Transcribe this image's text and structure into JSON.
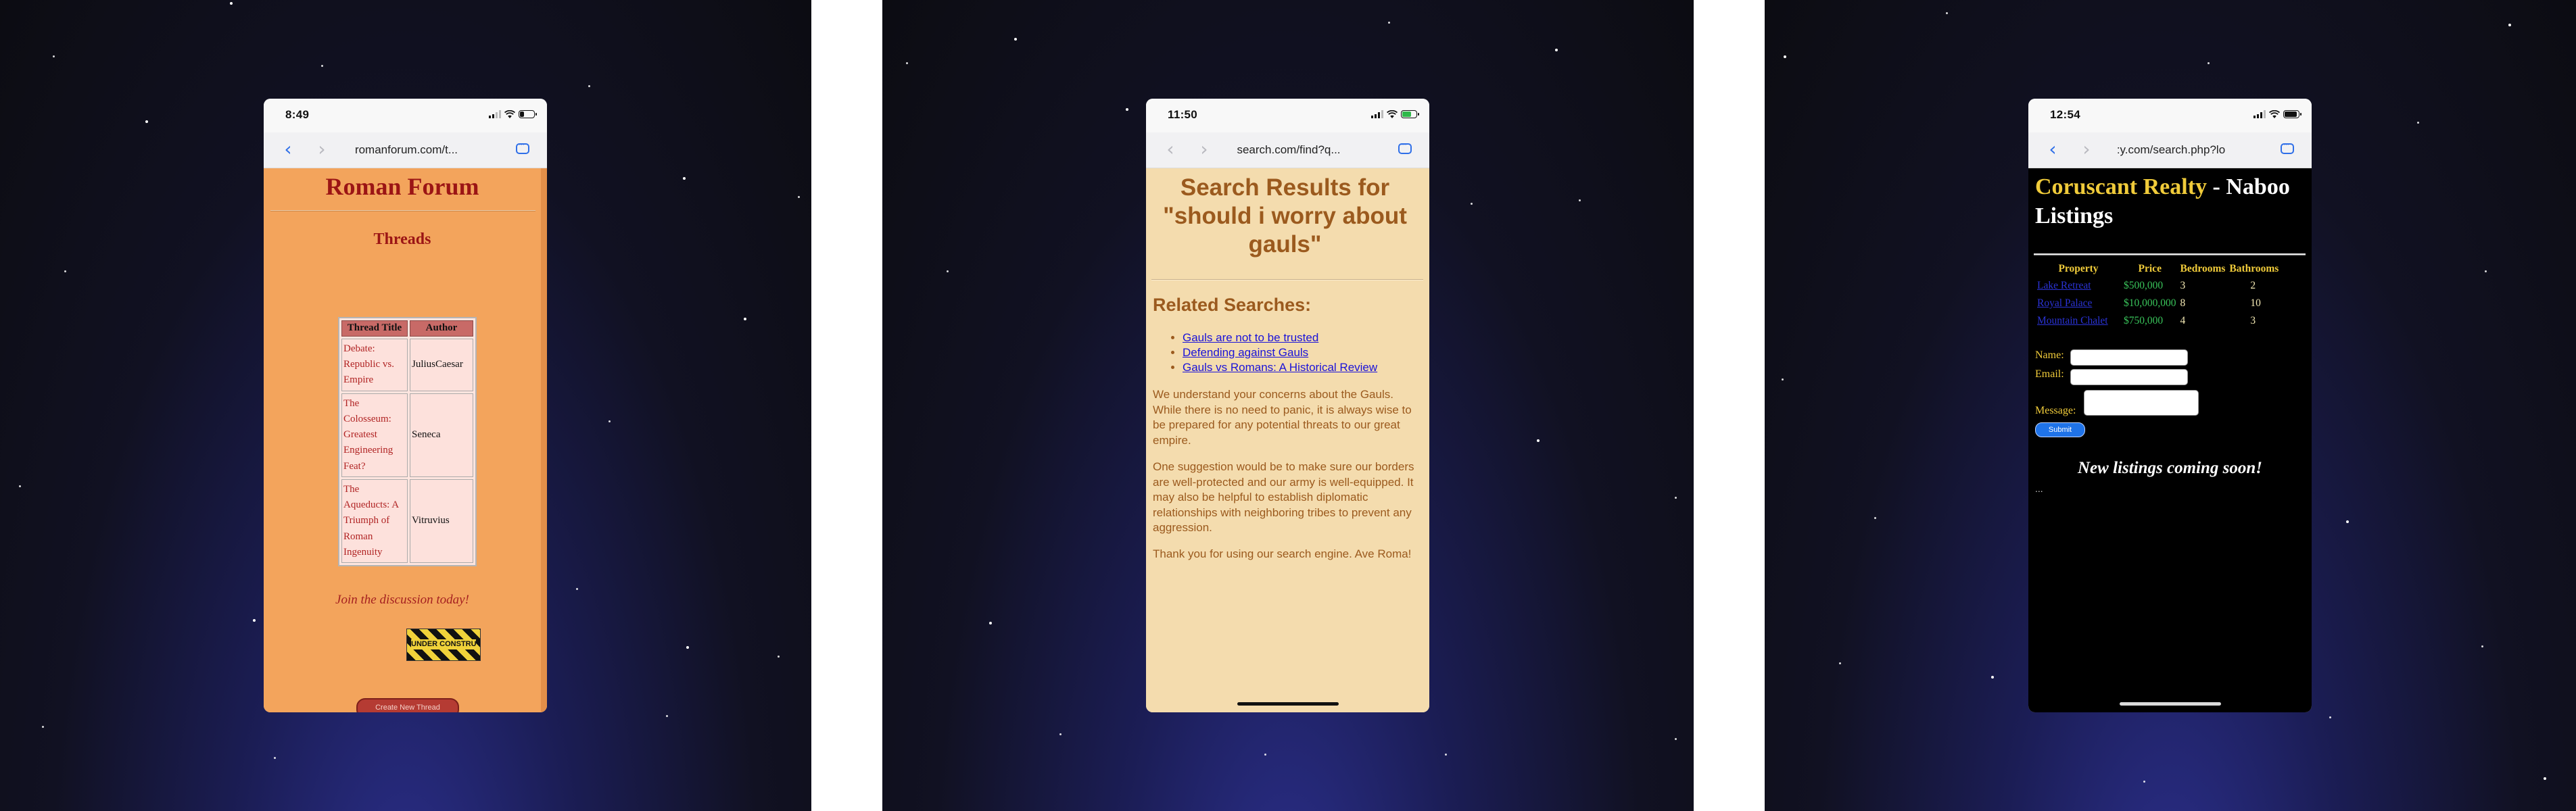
{
  "screens": [
    {
      "status": {
        "time": "8:49",
        "battery_level": 0.3
      },
      "browser": {
        "url": "romanforum.com/t..."
      },
      "page": {
        "title": "Roman Forum",
        "subtitle": "Threads",
        "table": {
          "headers": [
            "Thread Title",
            "Author"
          ],
          "rows": [
            {
              "title": "Debate: Republic vs. Empire",
              "author": "JuliusCaesar"
            },
            {
              "title": "The Colosseum: Greatest Engineering Feat?",
              "author": "Seneca"
            },
            {
              "title": "The Aqueducts: A Triumph of Roman Ingenuity",
              "author": "Vitruvius"
            }
          ]
        },
        "cta": "Join the discussion today!",
        "construction_sign": "UNDER CONSTRUCTION",
        "new_thread_button": "Create New Thread"
      }
    },
    {
      "status": {
        "time": "11:50",
        "battery_level": 0.65,
        "charging": true
      },
      "browser": {
        "url": "search.com/find?q..."
      },
      "page": {
        "title": "Search Results for \"should i worry about gauls\"",
        "related_heading": "Related Searches:",
        "related_links": [
          "Gauls are not to be trusted",
          "Defending against Gauls",
          "Gauls vs Romans: A Historical Review"
        ],
        "paragraphs": [
          "We understand your concerns about the Gauls. While there is no need to panic, it is always wise to be prepared for any potential threats to our great empire.",
          "One suggestion would be to make sure our borders are well-protected and our army is well-equipped. It may also be helpful to establish diplomatic relationships with neighboring tribes to prevent any aggression.",
          "Thank you for using our search engine. Ave Roma!"
        ]
      }
    },
    {
      "status": {
        "time": "12:54",
        "battery_level": 0.9
      },
      "browser": {
        "url": ":y.com/search.php?lo"
      },
      "page": {
        "title_brand": "Coruscant Realty",
        "title_rest": " - Naboo Listings",
        "table": {
          "headers": [
            "Property",
            "Price",
            "Bedrooms",
            "Bathrooms"
          ],
          "rows": [
            {
              "property": "Lake Retreat",
              "price": "$500,000",
              "bedrooms": "3",
              "bathrooms": "2"
            },
            {
              "property": "Royal Palace",
              "price": "$10,000,000",
              "bedrooms": "8",
              "bathrooms": "10"
            },
            {
              "property": "Mountain Chalet",
              "price": "$750,000",
              "bedrooms": "4",
              "bathrooms": "3"
            }
          ]
        },
        "form": {
          "name_label": "Name:",
          "email_label": "Email:",
          "message_label": "Message:",
          "submit_label": "Submit"
        },
        "coming_soon": "New listings coming soon!",
        "ellipsis": "..."
      }
    }
  ],
  "colors": {
    "roman_bg": "#f3a45c",
    "roman_red": "#9b1515",
    "search_bg": "#f4dcae",
    "search_brown": "#9b5a1e",
    "link_blue": "#1a12d9",
    "realty_gold": "#f0cb3a",
    "realty_green": "#39c35a",
    "ios_blue": "#2f6fe8"
  },
  "icons": [
    "back-chevron-icon",
    "forward-chevron-icon",
    "chat-bubble-icon",
    "signal-icon",
    "wifi-icon",
    "battery-icon"
  ]
}
